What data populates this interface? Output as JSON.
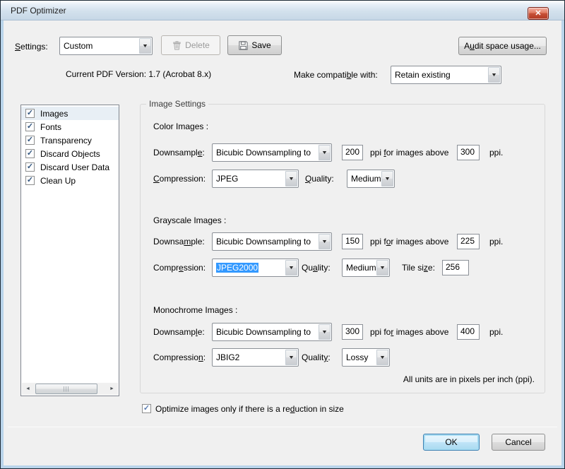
{
  "window": {
    "title": "PDF Optimizer"
  },
  "icons": {
    "close": "✕",
    "check": "✓",
    "dropdown_arrow": "▼",
    "scroll_left": "◄",
    "scroll_right": "►",
    "grip": "|||"
  },
  "colors": {
    "selection_blue": "#3399ff",
    "close_red": "#c75138",
    "dialog_frame_blue": "#b9d4ea",
    "content_gray": "#f0f0f0"
  },
  "toolbar": {
    "settings_label": {
      "pre": "",
      "key": "S",
      "post": "ettings:"
    },
    "settings_value": "Custom",
    "delete_label": "Delete",
    "save_label": "Save",
    "audit_label": {
      "pre": "A",
      "key": "u",
      "post": "dit space usage..."
    }
  },
  "version_row": {
    "current_version": "Current PDF Version: 1.7 (Acrobat 8.x)",
    "compat_label": {
      "pre": "Make compati",
      "key": "b",
      "post": "le with:"
    },
    "compat_value": "Retain existing"
  },
  "panel_list": {
    "items": [
      {
        "label": "Images",
        "checked": true,
        "selected": true
      },
      {
        "label": "Fonts",
        "checked": true,
        "selected": false
      },
      {
        "label": "Transparency",
        "checked": true,
        "selected": false
      },
      {
        "label": "Discard Objects",
        "checked": true,
        "selected": false
      },
      {
        "label": "Discard User Data",
        "checked": true,
        "selected": false
      },
      {
        "label": "Clean Up",
        "checked": true,
        "selected": false
      }
    ]
  },
  "image_settings": {
    "group_title": "Image Settings",
    "color": {
      "heading": "Color Images :",
      "downsample_label": {
        "pre": "Downsampl",
        "key": "e",
        "post": ":"
      },
      "downsample_value": "Bicubic Downsampling to",
      "ppi_value": "200",
      "between_label": {
        "pre": "ppi ",
        "key": "f",
        "post": "or images above"
      },
      "threshold_value": "300",
      "ppi_unit": "ppi.",
      "compression_label": {
        "pre": "",
        "key": "C",
        "post": "ompression:"
      },
      "compression_value": "JPEG",
      "quality_label": {
        "pre": "",
        "key": "Q",
        "post": "uality:"
      },
      "quality_value": "Medium"
    },
    "grayscale": {
      "heading": "Grayscale Images :",
      "downsample_label": {
        "pre": "Downsa",
        "key": "m",
        "post": "ple:"
      },
      "downsample_value": "Bicubic Downsampling to",
      "ppi_value": "150",
      "between_label": {
        "pre": "ppi f",
        "key": "o",
        "post": "r images above"
      },
      "threshold_value": "225",
      "ppi_unit": "ppi.",
      "compression_label": {
        "pre": "Compr",
        "key": "e",
        "post": "ssion:"
      },
      "compression_value": "JPEG2000",
      "compression_value_selected": true,
      "quality_label": {
        "pre": "Qu",
        "key": "a",
        "post": "lity:"
      },
      "quality_value": "Medium",
      "tile_label": {
        "pre": "Tile si",
        "key": "z",
        "post": "e:"
      },
      "tile_value": "256"
    },
    "monochrome": {
      "heading": "Monochrome Images :",
      "downsample_label": {
        "pre": "Downsamp",
        "key": "l",
        "post": "e:"
      },
      "downsample_value": "Bicubic Downsampling to",
      "ppi_value": "300",
      "between_label": {
        "pre": "ppi fo",
        "key": "r",
        "post": " images above"
      },
      "threshold_value": "400",
      "ppi_unit": "ppi.",
      "compression_label": {
        "pre": "Compressio",
        "key": "n",
        "post": ":"
      },
      "compression_value": "JBIG2",
      "quality_label": {
        "pre": "Qualit",
        "key": "y",
        "post": ":"
      },
      "quality_value": "Lossy"
    },
    "units_note": "All units are in pixels per inch (ppi)."
  },
  "footer": {
    "optimize_label": {
      "pre": "Optimize images only if there is a re",
      "key": "d",
      "post": "uction in size"
    },
    "ok_label": "OK",
    "cancel_label": "Cancel"
  }
}
